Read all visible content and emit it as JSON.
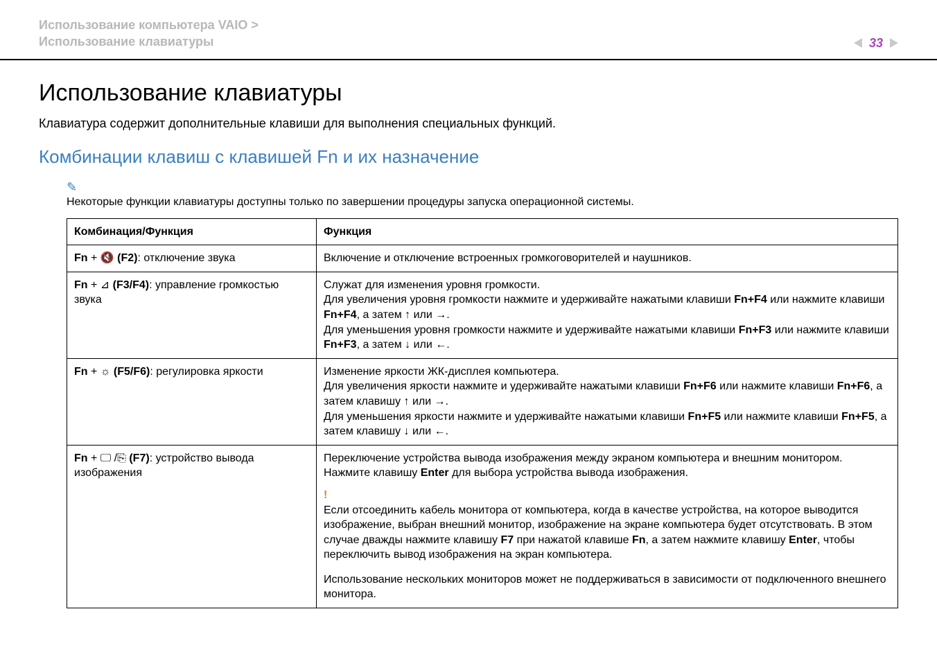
{
  "header": {
    "line1": "Использование компьютера VAIO >",
    "line2": "Использование клавиатуры",
    "page": "33"
  },
  "h1": "Использование клавиатуры",
  "intro": "Клавиатура содержит дополнительные клавиши для выполнения специальных функций.",
  "h2": "Комбинации клавиш с клавишей Fn и их назначение",
  "note": "Некоторые функции клавиатуры доступны только по завершении процедуры запуска операционной системы.",
  "table": {
    "head": {
      "col1": "Комбинация/Функция",
      "col2": "Функция"
    },
    "rows": [
      {
        "combo_prefix": "Fn",
        "combo_plus": " + ",
        "combo_glyph": "🔇",
        "combo_key": " (F2)",
        "combo_label": ": отключение звука",
        "func_plain": "Включение и отключение встроенных громкоговорителей и наушников."
      },
      {
        "combo_prefix": "Fn",
        "combo_plus": " + ",
        "combo_glyph": "⊿",
        "combo_key": " (F3/F4)",
        "combo_label": ": управление громкостью звука",
        "f_line1": "Служат для изменения уровня громкости.",
        "f_l2a": "Для увеличения уровня громкости нажмите и удерживайте нажатыми клавиши ",
        "f_l2b": "Fn+F4",
        "f_l2c": " или нажмите клавиши ",
        "f_l2d": "Fn+F4",
        "f_l2e": ", а затем ",
        "f_l2f": "↑",
        "f_l2g": " или ",
        "f_l2h": "→",
        "f_l2i": ".",
        "f_l3a": "Для уменьшения уровня громкости нажмите и удерживайте нажатыми клавиши ",
        "f_l3b": "Fn+F3",
        "f_l3c": " или нажмите клавиши ",
        "f_l3d": "Fn+F3",
        "f_l3e": ", а затем ",
        "f_l3f": "↓",
        "f_l3g": " или ",
        "f_l3h": "←",
        "f_l3i": "."
      },
      {
        "combo_prefix": "Fn",
        "combo_plus": " + ",
        "combo_glyph": "☼",
        "combo_key": " (F5/F6)",
        "combo_label": ": регулировка яркости",
        "f_line1": "Изменение яркости ЖК-дисплея компьютера.",
        "f_l2a": "Для увеличения яркости нажмите и удерживайте нажатыми клавиши ",
        "f_l2b": "Fn+F6",
        "f_l2c": " или нажмите клавиши ",
        "f_l2d": "Fn+F6",
        "f_l2e": ", а затем клавишу ",
        "f_l2f": "↑",
        "f_l2g": " или ",
        "f_l2h": "→",
        "f_l2i": ".",
        "f_l3a": "Для уменьшения яркости нажмите и удерживайте нажатыми клавиши ",
        "f_l3b": "Fn+F5",
        "f_l3c": " или нажмите клавиши ",
        "f_l3d": "Fn+F5",
        "f_l3e": ", а затем клавишу ",
        "f_l3f": "↓",
        "f_l3g": " или ",
        "f_l3h": "←",
        "f_l3i": "."
      },
      {
        "combo_prefix": "Fn",
        "combo_plus": " + ",
        "combo_glyph": "🖵 /⎘",
        "combo_key": " (F7)",
        "combo_label": ": устройство вывода изображения",
        "p1a": "Переключение устройства вывода изображения между экраном компьютера и внешним монитором. Нажмите клавишу ",
        "p1b": "Enter",
        "p1c": " для выбора устройства вывода изображения.",
        "warn_mark": "!",
        "p2a": "Если отсоединить кабель монитора от компьютера, когда в качестве устройства, на которое выводится изображение, выбран внешний монитор, изображение на экране компьютера будет отсутствовать. В этом случае дважды нажмите клавишу ",
        "p2b": "F7",
        "p2c": " при нажатой клавише ",
        "p2d": "Fn",
        "p2e": ", а затем нажмите клавишу ",
        "p2f": "Enter",
        "p2g": ", чтобы переключить вывод изображения на экран компьютера.",
        "p3": "Использование нескольких мониторов может не поддерживаться в зависимости от подключенного внешнего монитора."
      }
    ]
  }
}
